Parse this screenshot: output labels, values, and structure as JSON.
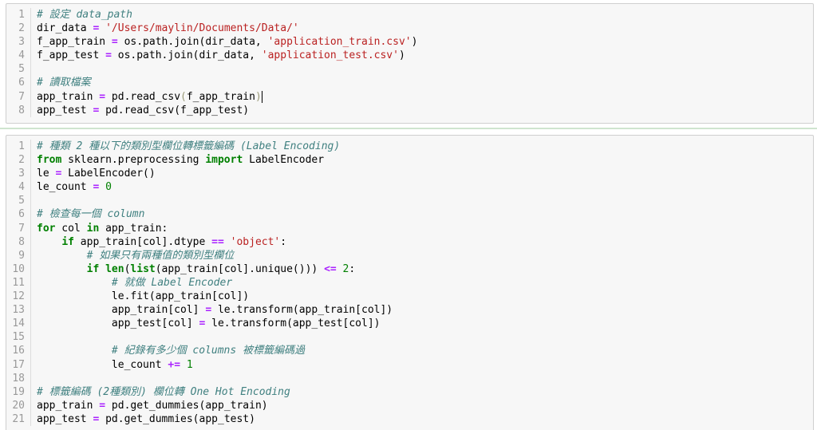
{
  "cells": [
    {
      "lines": [
        [
          {
            "t": "comment",
            "v": "# 設定 data_path"
          }
        ],
        [
          {
            "t": "plain",
            "v": "dir_data "
          },
          {
            "t": "op",
            "v": "="
          },
          {
            "t": "plain",
            "v": " "
          },
          {
            "t": "string",
            "v": "'/Users/maylin/Documents/Data/'"
          }
        ],
        [
          {
            "t": "plain",
            "v": "f_app_train "
          },
          {
            "t": "op",
            "v": "="
          },
          {
            "t": "plain",
            "v": " os.path.join(dir_data, "
          },
          {
            "t": "string",
            "v": "'application_train.csv'"
          },
          {
            "t": "plain",
            "v": ")"
          }
        ],
        [
          {
            "t": "plain",
            "v": "f_app_test "
          },
          {
            "t": "op",
            "v": "="
          },
          {
            "t": "plain",
            "v": " os.path.join(dir_data, "
          },
          {
            "t": "string",
            "v": "'application_test.csv'"
          },
          {
            "t": "plain",
            "v": ")"
          }
        ],
        [],
        [
          {
            "t": "comment",
            "v": "# 讀取檔案"
          }
        ],
        [
          {
            "t": "plain",
            "v": "app_train "
          },
          {
            "t": "op",
            "v": "="
          },
          {
            "t": "plain",
            "v": " pd.read_csv"
          },
          {
            "t": "paren",
            "v": "("
          },
          {
            "t": "plain",
            "v": "f_app_train"
          },
          {
            "t": "paren",
            "v": ")"
          },
          {
            "t": "cursor",
            "v": ""
          }
        ],
        [
          {
            "t": "plain",
            "v": "app_test "
          },
          {
            "t": "op",
            "v": "="
          },
          {
            "t": "plain",
            "v": " pd.read_csv(f_app_test)"
          }
        ]
      ]
    },
    {
      "lines": [
        [
          {
            "t": "comment",
            "v": "# 種類 2 種以下的類別型欄位轉標籤編碼 (Label Encoding)"
          }
        ],
        [
          {
            "t": "keyword",
            "v": "from"
          },
          {
            "t": "plain",
            "v": " sklearn.preprocessing "
          },
          {
            "t": "keyword",
            "v": "import"
          },
          {
            "t": "plain",
            "v": " LabelEncoder"
          }
        ],
        [
          {
            "t": "plain",
            "v": "le "
          },
          {
            "t": "op",
            "v": "="
          },
          {
            "t": "plain",
            "v": " LabelEncoder()"
          }
        ],
        [
          {
            "t": "plain",
            "v": "le_count "
          },
          {
            "t": "op",
            "v": "="
          },
          {
            "t": "plain",
            "v": " "
          },
          {
            "t": "number",
            "v": "0"
          }
        ],
        [],
        [
          {
            "t": "comment",
            "v": "# 檢查每一個 column"
          }
        ],
        [
          {
            "t": "keyword",
            "v": "for"
          },
          {
            "t": "plain",
            "v": " col "
          },
          {
            "t": "keyword",
            "v": "in"
          },
          {
            "t": "plain",
            "v": " app_train:"
          }
        ],
        [
          {
            "t": "plain",
            "v": "    "
          },
          {
            "t": "keyword",
            "v": "if"
          },
          {
            "t": "plain",
            "v": " app_train[col].dtype "
          },
          {
            "t": "op",
            "v": "=="
          },
          {
            "t": "plain",
            "v": " "
          },
          {
            "t": "string",
            "v": "'object'"
          },
          {
            "t": "plain",
            "v": ":"
          }
        ],
        [
          {
            "t": "plain",
            "v": "        "
          },
          {
            "t": "comment",
            "v": "# 如果只有兩種值的類別型欄位"
          }
        ],
        [
          {
            "t": "plain",
            "v": "        "
          },
          {
            "t": "keyword",
            "v": "if"
          },
          {
            "t": "plain",
            "v": " "
          },
          {
            "t": "keyword",
            "v": "len"
          },
          {
            "t": "plain",
            "v": "("
          },
          {
            "t": "keyword",
            "v": "list"
          },
          {
            "t": "plain",
            "v": "(app_train[col].unique())) "
          },
          {
            "t": "op",
            "v": "<="
          },
          {
            "t": "plain",
            "v": " "
          },
          {
            "t": "number",
            "v": "2"
          },
          {
            "t": "plain",
            "v": ":"
          }
        ],
        [
          {
            "t": "plain",
            "v": "            "
          },
          {
            "t": "comment",
            "v": "# 就做 Label Encoder"
          }
        ],
        [
          {
            "t": "plain",
            "v": "            le.fit(app_train[col])"
          }
        ],
        [
          {
            "t": "plain",
            "v": "            app_train[col] "
          },
          {
            "t": "op",
            "v": "="
          },
          {
            "t": "plain",
            "v": " le.transform(app_train[col])"
          }
        ],
        [
          {
            "t": "plain",
            "v": "            app_test[col] "
          },
          {
            "t": "op",
            "v": "="
          },
          {
            "t": "plain",
            "v": " le.transform(app_test[col])"
          }
        ],
        [],
        [
          {
            "t": "plain",
            "v": "            "
          },
          {
            "t": "comment",
            "v": "# 紀錄有多少個 columns 被標籤編碼過"
          }
        ],
        [
          {
            "t": "plain",
            "v": "            le_count "
          },
          {
            "t": "op",
            "v": "+="
          },
          {
            "t": "plain",
            "v": " "
          },
          {
            "t": "number",
            "v": "1"
          }
        ],
        [],
        [
          {
            "t": "comment",
            "v": "# 標籤編碼 (2種類別) 欄位轉 One Hot Encoding"
          }
        ],
        [
          {
            "t": "plain",
            "v": "app_train "
          },
          {
            "t": "op",
            "v": "="
          },
          {
            "t": "plain",
            "v": " pd.get_dummies(app_train)"
          }
        ],
        [
          {
            "t": "plain",
            "v": "app_test "
          },
          {
            "t": "op",
            "v": "="
          },
          {
            "t": "plain",
            "v": " pd.get_dummies(app_test)"
          }
        ]
      ]
    }
  ]
}
